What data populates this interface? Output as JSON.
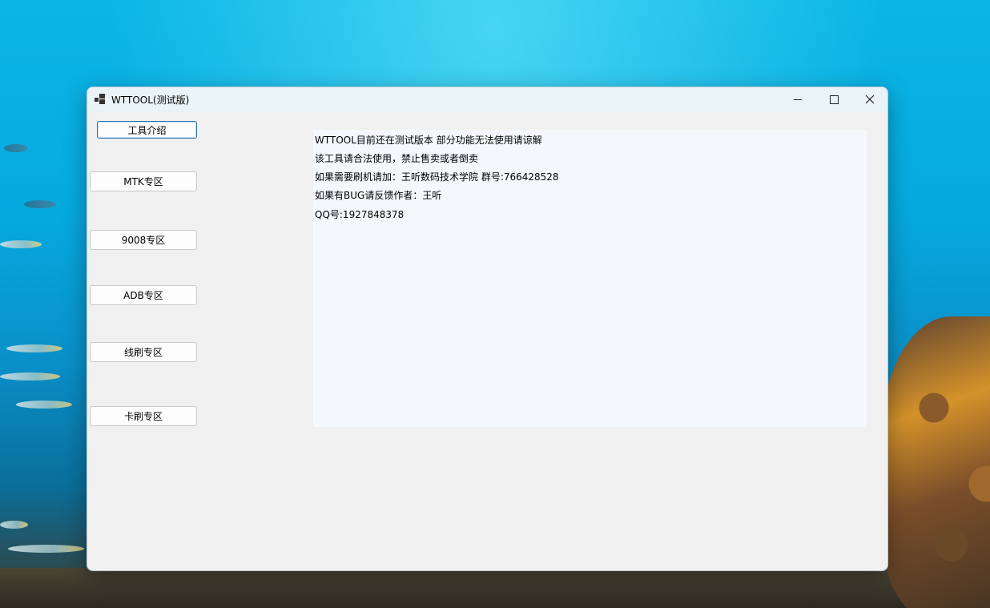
{
  "window": {
    "title": "WTTOOL(测试版)"
  },
  "sidebar": {
    "buttons": [
      {
        "label": "工具介绍"
      },
      {
        "label": "MTK专区"
      },
      {
        "label": "9008专区"
      },
      {
        "label": "ADB专区"
      },
      {
        "label": "线刷专区"
      },
      {
        "label": "卡刷专区"
      }
    ]
  },
  "info": {
    "lines": [
      "WTTOOL目前还在测试版本     部分功能无法使用请谅解",
      "该工具请合法使用，禁止售卖或者倒卖",
      "如果需要刷机请加：王听数码技术学院 群号:766428528",
      "如果有BUG请反馈作者：王听",
      "QQ号:1927848378"
    ]
  },
  "icons": {
    "app": "app-icon",
    "minimize": "minimize-icon",
    "maximize": "maximize-icon",
    "close": "close-icon"
  }
}
